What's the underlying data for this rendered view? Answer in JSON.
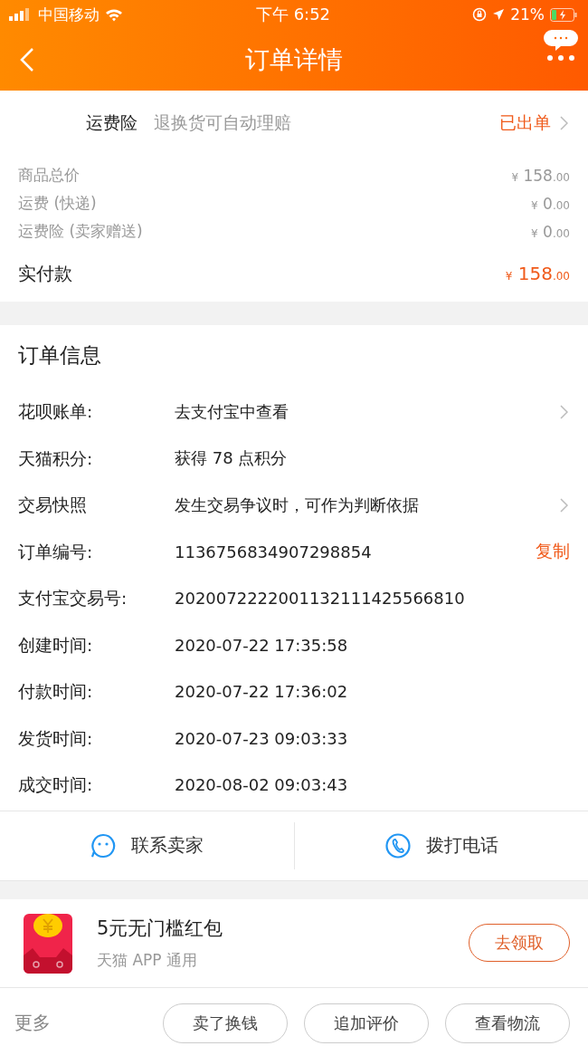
{
  "status_bar": {
    "carrier": "中国移动",
    "time": "下午 6:52",
    "battery": "21%"
  },
  "nav": {
    "title": "订单详情"
  },
  "insurance": {
    "label": "运费险",
    "desc": "退换货可自动理赔",
    "status": "已出单"
  },
  "prices": [
    {
      "label": "商品总价",
      "symbol": "¥",
      "whole": "158",
      "cents": ".00"
    },
    {
      "label": "运费 (快递)",
      "symbol": "¥",
      "whole": "0",
      "cents": ".00"
    },
    {
      "label": "运费险 (卖家赠送)",
      "symbol": "¥",
      "whole": "0",
      "cents": ".00"
    }
  ],
  "total": {
    "label": "实付款",
    "symbol": "¥",
    "whole": "158",
    "cents": ".00"
  },
  "order_info": {
    "title": "订单信息",
    "rows": [
      {
        "label": "花呗账单:",
        "value": "去支付宝中查看",
        "chevron": true
      },
      {
        "label": "天猫积分:",
        "value": "获得 78 点积分",
        "chevron": false
      },
      {
        "label": "交易快照",
        "value": "发生交易争议时，可作为判断依据",
        "chevron": true
      },
      {
        "label": "订单编号:",
        "value": "1136756834907298854",
        "chevron": false,
        "link": "复制"
      },
      {
        "label": "支付宝交易号:",
        "value": "2020072222001132111425566810",
        "chevron": false
      },
      {
        "label": "创建时间:",
        "value": "2020-07-22 17:35:58",
        "chevron": false
      },
      {
        "label": "付款时间:",
        "value": "2020-07-22 17:36:02",
        "chevron": false
      },
      {
        "label": "发货时间:",
        "value": "2020-07-23 09:03:33",
        "chevron": false
      },
      {
        "label": "成交时间:",
        "value": "2020-08-02 09:03:43",
        "chevron": false
      }
    ]
  },
  "contacts": [
    {
      "kind": "chat",
      "label": "联系卖家"
    },
    {
      "kind": "phone",
      "label": "拨打电话"
    }
  ],
  "red_packet": {
    "title": "5元无门槛红包",
    "subtitle": "天猫 APP 通用",
    "button": "去领取"
  },
  "bottom_bar": {
    "more": "更多",
    "buttons": [
      "卖了换钱",
      "追加评价",
      "查看物流"
    ]
  }
}
